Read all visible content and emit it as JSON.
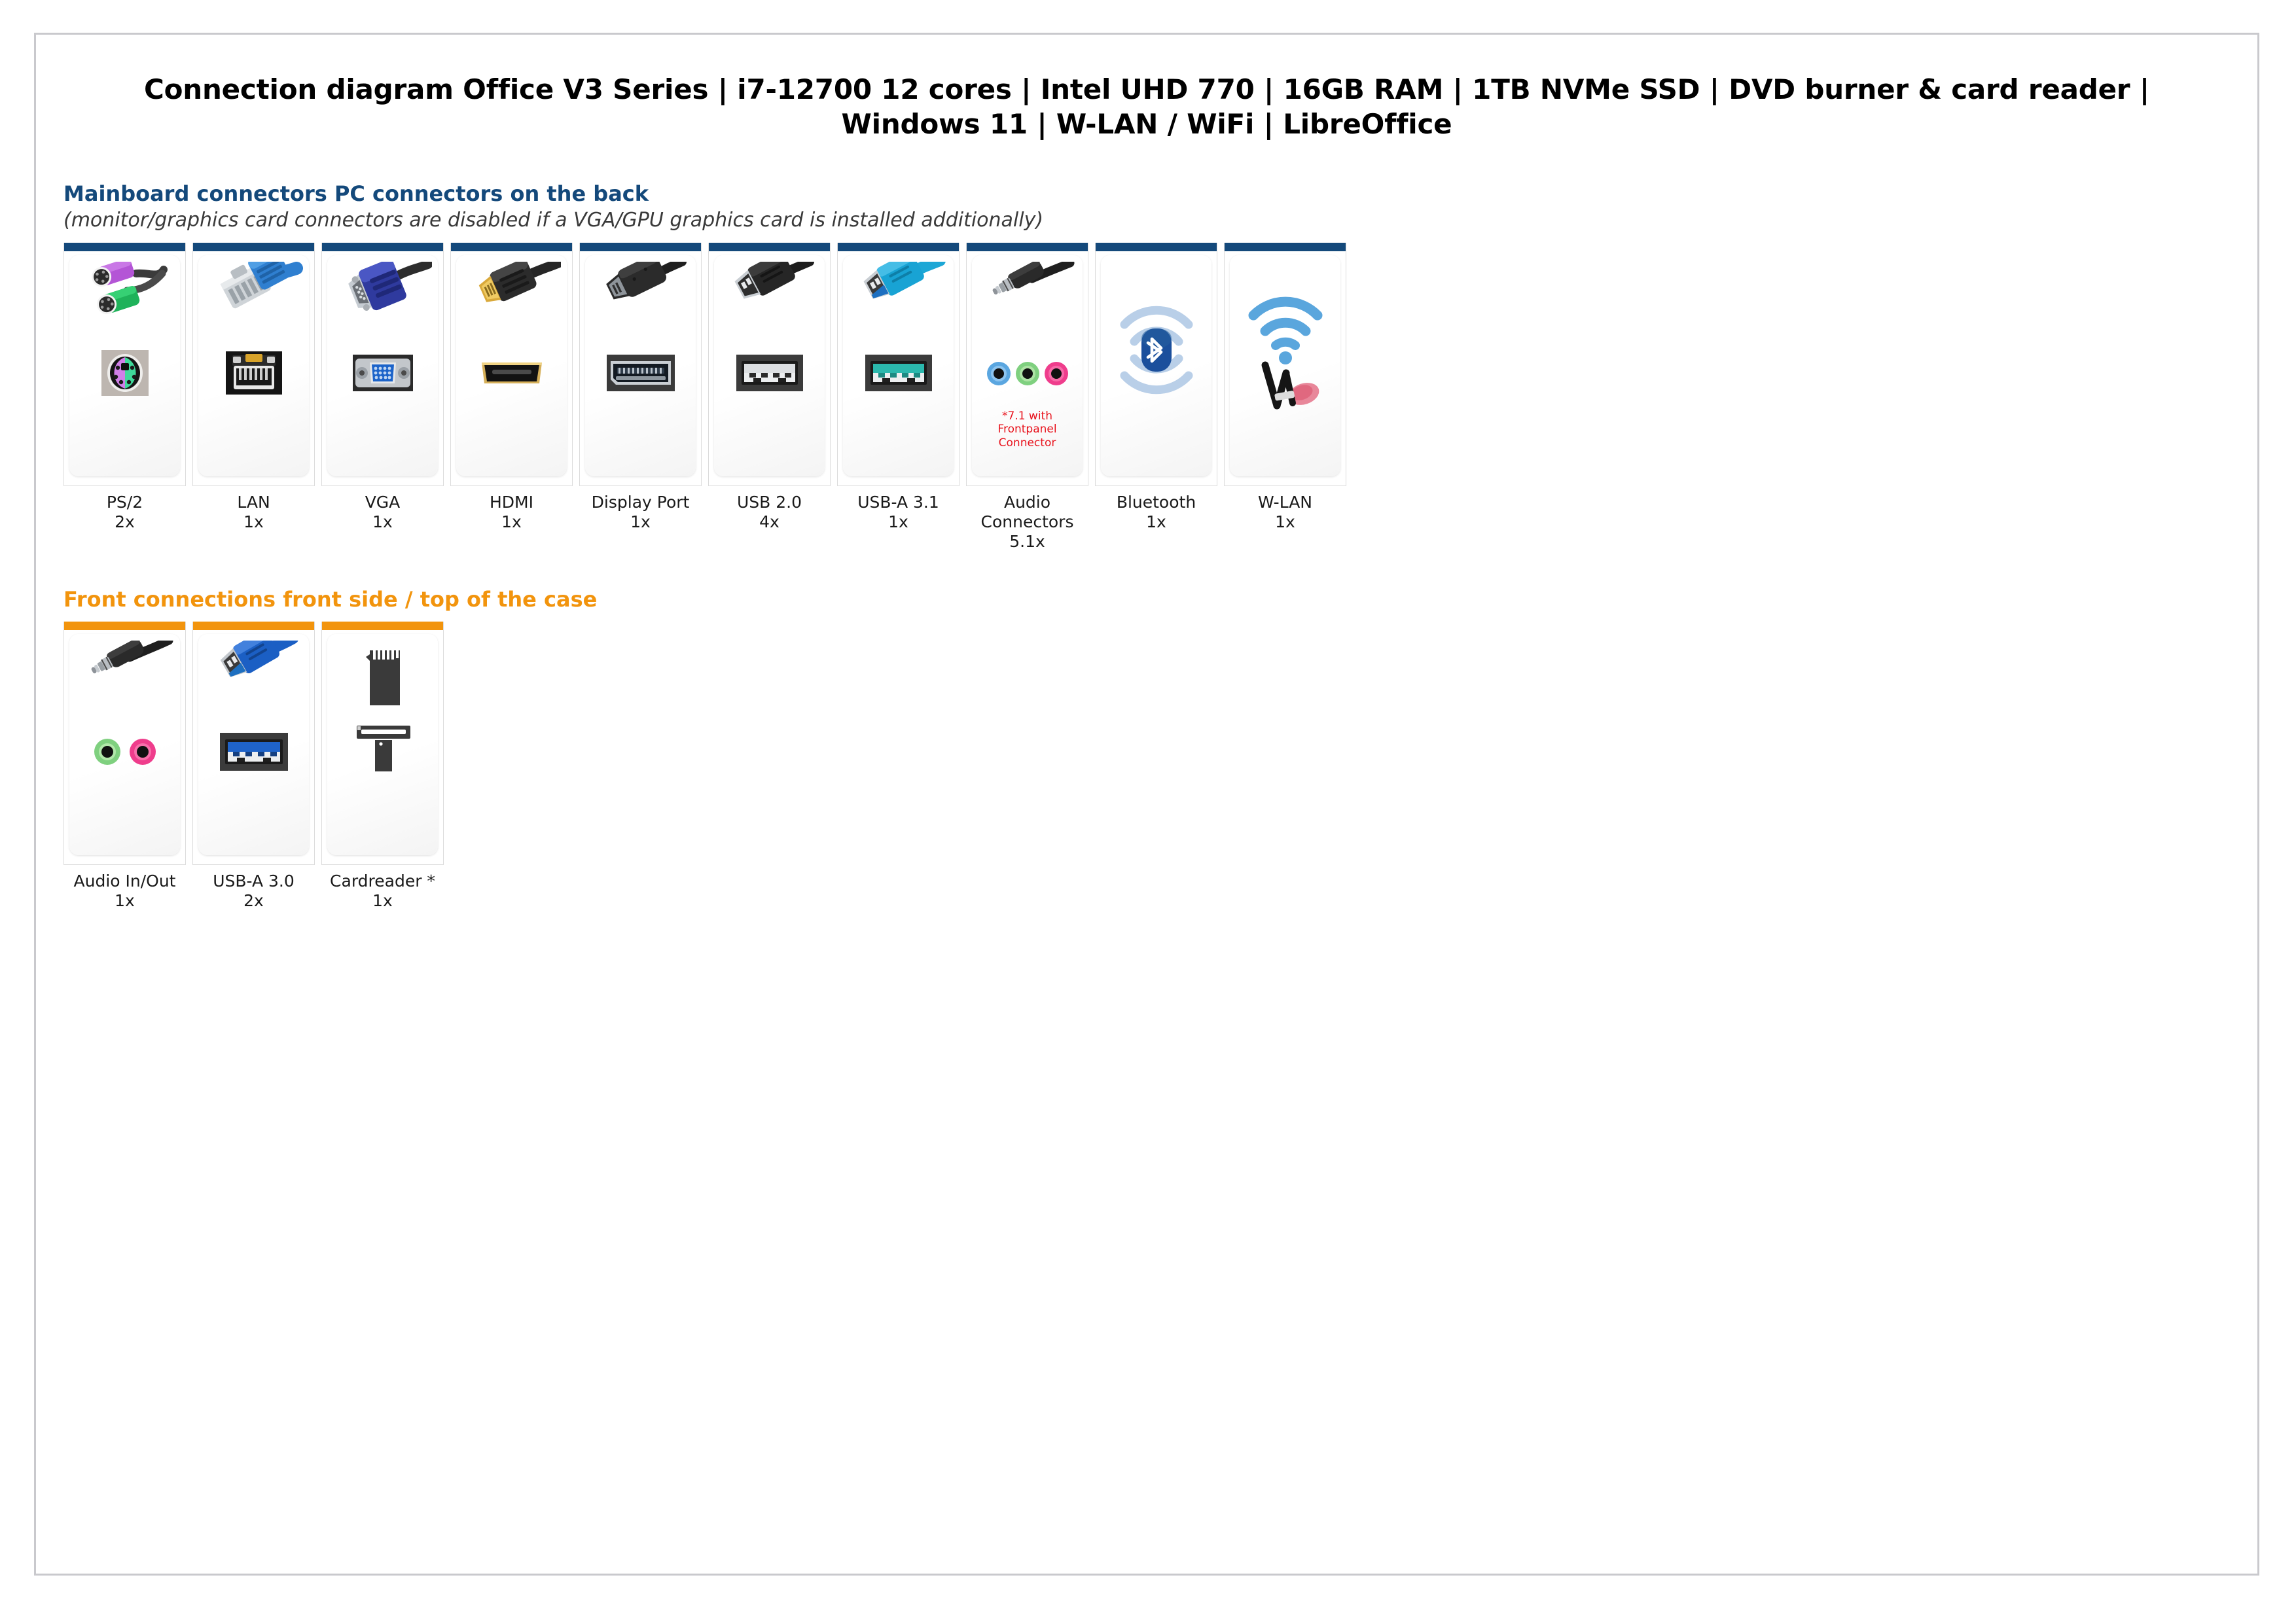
{
  "document": {
    "title": "Connection diagram Office V3 Series | i7-12700 12 cores | Intel UHD 770 | 16GB RAM | 1TB NVMe SSD | DVD burner & card reader | Windows 11 | W-LAN / WiFi | LibreOffice"
  },
  "colors": {
    "blue_accent": "#14497b",
    "orange_accent": "#f2940d",
    "note_red": "#e8141e",
    "page_border": "#c9c9cd"
  },
  "sections": [
    {
      "id": "mainboard",
      "heading": "Mainboard connectors PC connectors on the back",
      "subheading": "(monitor/graphics card connectors are disabled if a VGA/GPU graphics card is installed additionally)",
      "accent": "blue",
      "cards": [
        {
          "icon": "ps2-connector-icon",
          "name": "PS/2",
          "qty": "2x",
          "note": ""
        },
        {
          "icon": "lan-rj45-connector-icon",
          "name": "LAN",
          "qty": "1x",
          "note": ""
        },
        {
          "icon": "vga-connector-icon",
          "name": "VGA",
          "qty": "1x",
          "note": ""
        },
        {
          "icon": "hdmi-connector-icon",
          "name": "HDMI",
          "qty": "1x",
          "note": ""
        },
        {
          "icon": "displayport-connector-icon",
          "name": "Display Port",
          "qty": "1x",
          "note": ""
        },
        {
          "icon": "usb2-connector-icon",
          "name": "USB 2.0",
          "qty": "4x",
          "note": ""
        },
        {
          "icon": "usb-a-31-connector-icon",
          "name": "USB-A 3.1",
          "qty": "1x",
          "note": ""
        },
        {
          "icon": "audio-jack-connector-icon",
          "name": "Audio Connectors",
          "qty": "5.1x",
          "note": "*7.1 with Frontpanel Connector"
        },
        {
          "icon": "bluetooth-icon",
          "name": "Bluetooth",
          "qty": "1x",
          "note": ""
        },
        {
          "icon": "wlan-wifi-icon",
          "name": "W-LAN",
          "qty": "1x",
          "note": ""
        }
      ]
    },
    {
      "id": "front",
      "heading_part1": "Front connections front side",
      "heading_slash": " / ",
      "heading_part2": "top of the case",
      "accent": "orange",
      "cards": [
        {
          "icon": "audio-in-out-icon",
          "name": "Audio In/Out",
          "qty": "1x",
          "note": ""
        },
        {
          "icon": "usb-a-30-connector-icon",
          "name": "USB-A 3.0",
          "qty": "2x",
          "note": ""
        },
        {
          "icon": "cardreader-icon",
          "name": "Cardreader *",
          "qty": "1x",
          "note": ""
        }
      ]
    }
  ]
}
